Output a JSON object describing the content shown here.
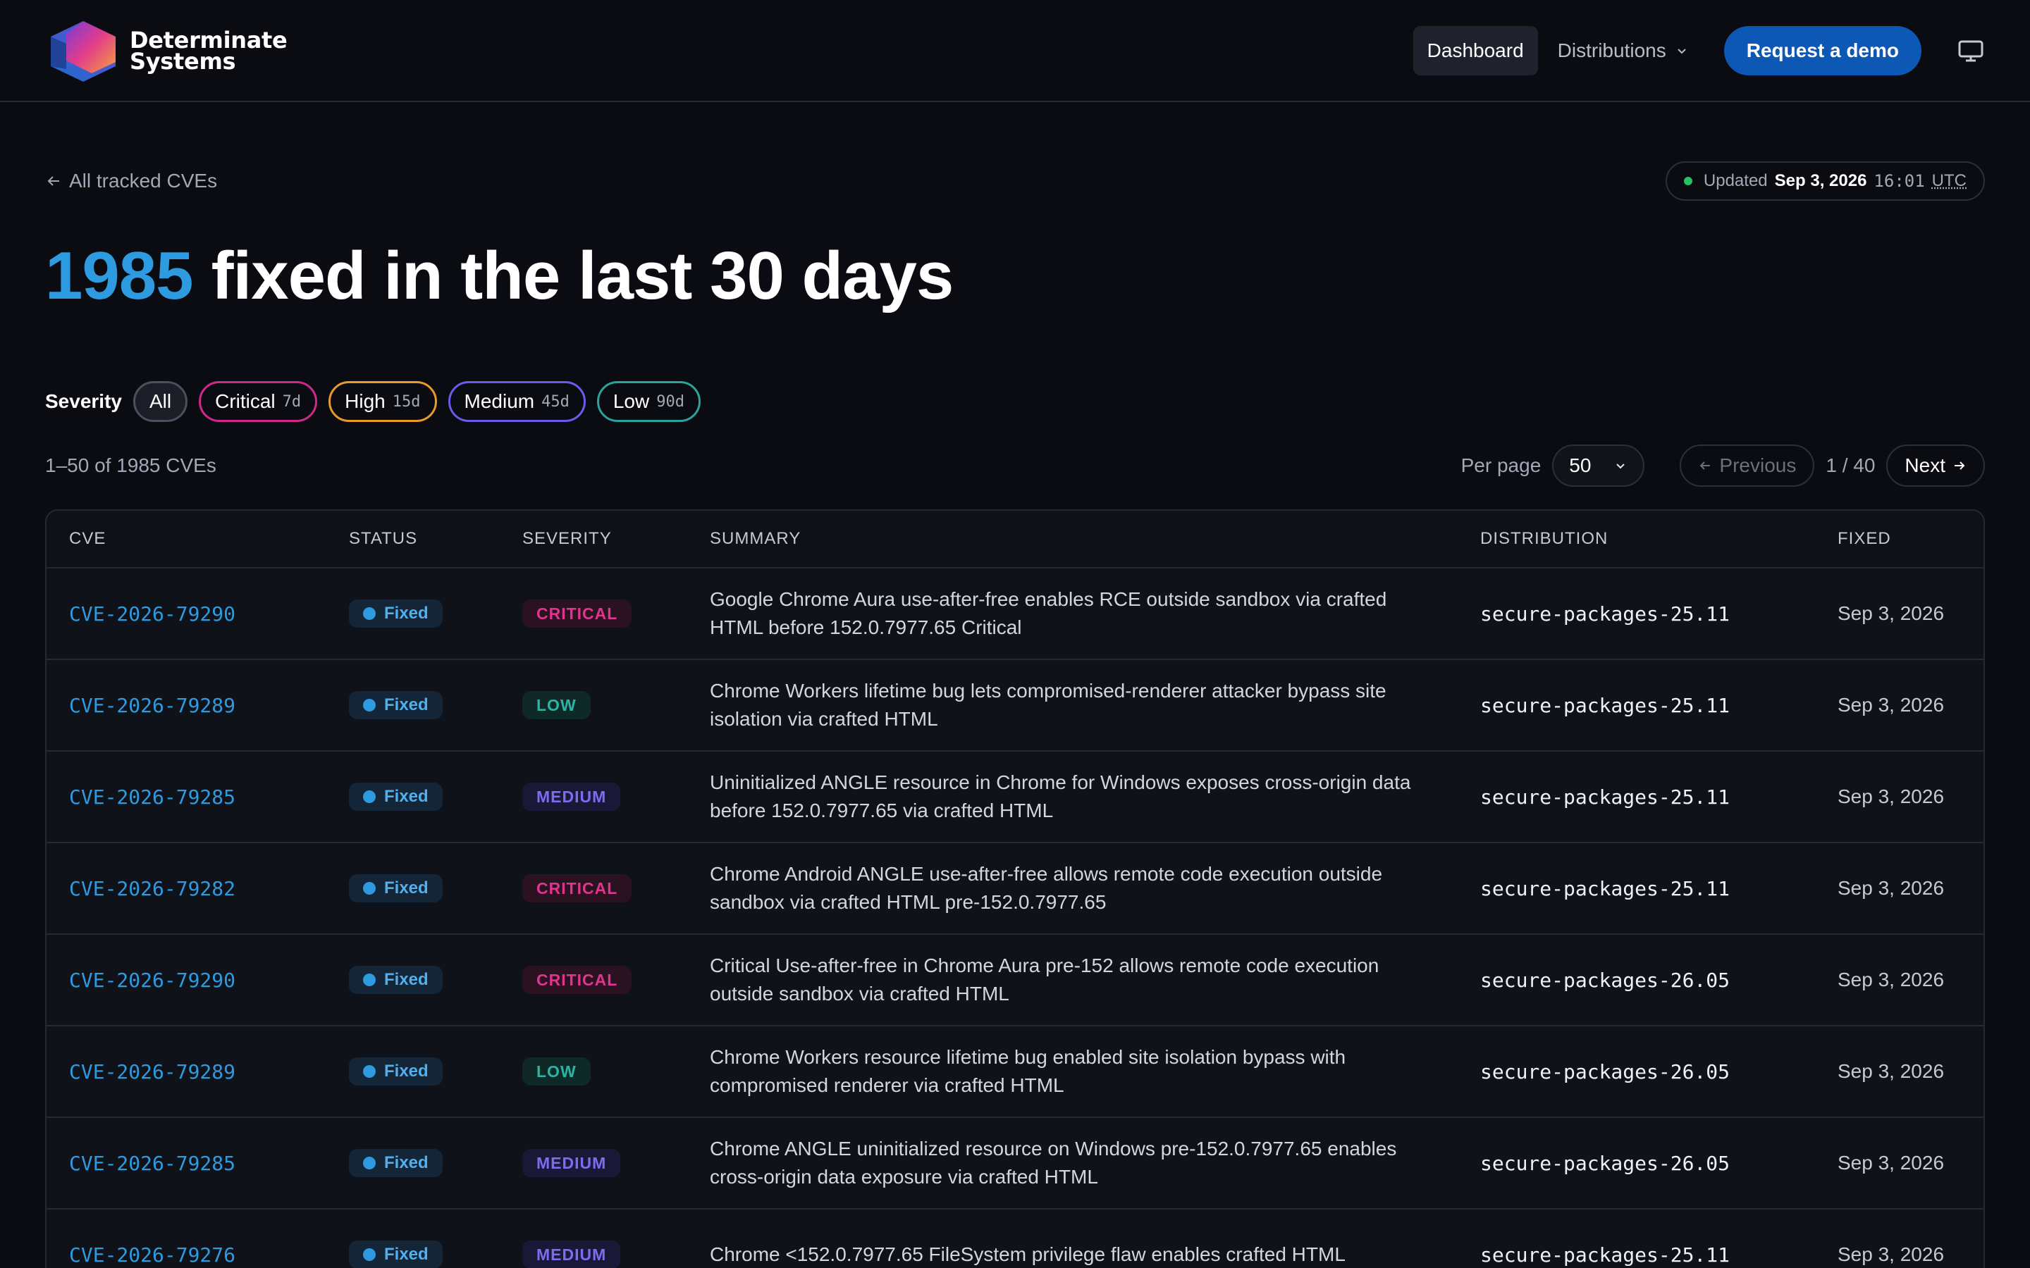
{
  "brand": {
    "line1": "Determinate",
    "line2": "Systems"
  },
  "nav": {
    "dashboard": "Dashboard",
    "distributions": "Distributions",
    "request_demo": "Request a demo"
  },
  "back_link": "All tracked CVEs",
  "updated": {
    "label": "Updated",
    "date": "Sep 3, 2026",
    "time": "16:01",
    "tz": "UTC"
  },
  "headline": {
    "count": "1985",
    "text": "fixed in the last 30 days"
  },
  "severity_filter": {
    "label": "Severity",
    "chips": [
      {
        "label": "All",
        "days": ""
      },
      {
        "label": "Critical",
        "days": "7d"
      },
      {
        "label": "High",
        "days": "15d"
      },
      {
        "label": "Medium",
        "days": "45d"
      },
      {
        "label": "Low",
        "days": "90d"
      }
    ]
  },
  "pagination": {
    "range": "1–50 of 1985 CVEs",
    "per_page_label": "Per page",
    "per_page_value": "50",
    "previous": "Previous",
    "page": "1 / 40",
    "next": "Next"
  },
  "table": {
    "headers": [
      "CVE",
      "STATUS",
      "SEVERITY",
      "SUMMARY",
      "DISTRIBUTION",
      "FIXED"
    ],
    "rows": [
      {
        "cve": "CVE-2026-79290",
        "status": "Fixed",
        "severity": "CRITICAL",
        "summary": "Google Chrome Aura use-after-free enables RCE outside sandbox via crafted HTML before 152.0.7977.65 Critical",
        "distribution": "secure-packages-25.11",
        "fixed": "Sep 3, 2026"
      },
      {
        "cve": "CVE-2026-79289",
        "status": "Fixed",
        "severity": "LOW",
        "summary": "Chrome Workers lifetime bug lets compromised-renderer attacker bypass site isolation via crafted HTML",
        "distribution": "secure-packages-25.11",
        "fixed": "Sep 3, 2026"
      },
      {
        "cve": "CVE-2026-79285",
        "status": "Fixed",
        "severity": "MEDIUM",
        "summary": "Uninitialized ANGLE resource in Chrome for Windows exposes cross-origin data before 152.0.7977.65 via crafted HTML",
        "distribution": "secure-packages-25.11",
        "fixed": "Sep 3, 2026"
      },
      {
        "cve": "CVE-2026-79282",
        "status": "Fixed",
        "severity": "CRITICAL",
        "summary": "Chrome Android ANGLE use-after-free allows remote code execution outside sandbox via crafted HTML pre-152.0.7977.65",
        "distribution": "secure-packages-25.11",
        "fixed": "Sep 3, 2026"
      },
      {
        "cve": "CVE-2026-79290",
        "status": "Fixed",
        "severity": "CRITICAL",
        "summary": "Critical Use-after-free in Chrome Aura pre-152 allows remote code execution outside sandbox via crafted HTML",
        "distribution": "secure-packages-26.05",
        "fixed": "Sep 3, 2026"
      },
      {
        "cve": "CVE-2026-79289",
        "status": "Fixed",
        "severity": "LOW",
        "summary": "Chrome Workers resource lifetime bug enabled site isolation bypass with compromised renderer via crafted HTML",
        "distribution": "secure-packages-26.05",
        "fixed": "Sep 3, 2026"
      },
      {
        "cve": "CVE-2026-79285",
        "status": "Fixed",
        "severity": "MEDIUM",
        "summary": "Chrome ANGLE uninitialized resource on Windows pre-152.0.7977.65 enables cross-origin data exposure via crafted HTML",
        "distribution": "secure-packages-26.05",
        "fixed": "Sep 3, 2026"
      },
      {
        "cve": "CVE-2026-79276",
        "status": "Fixed",
        "severity": "MEDIUM",
        "summary": "Chrome <152.0.7977.65 FileSystem privilege flaw enables crafted HTML",
        "distribution": "secure-packages-25.11",
        "fixed": "Sep 3, 2026"
      }
    ]
  },
  "colors": {
    "accent_blue": "#2e9ae0",
    "critical": "#e0348f",
    "high": "#e89a2a",
    "medium": "#7d6cf0",
    "low": "#2bb3a6",
    "primary_button": "#0d57b5"
  }
}
